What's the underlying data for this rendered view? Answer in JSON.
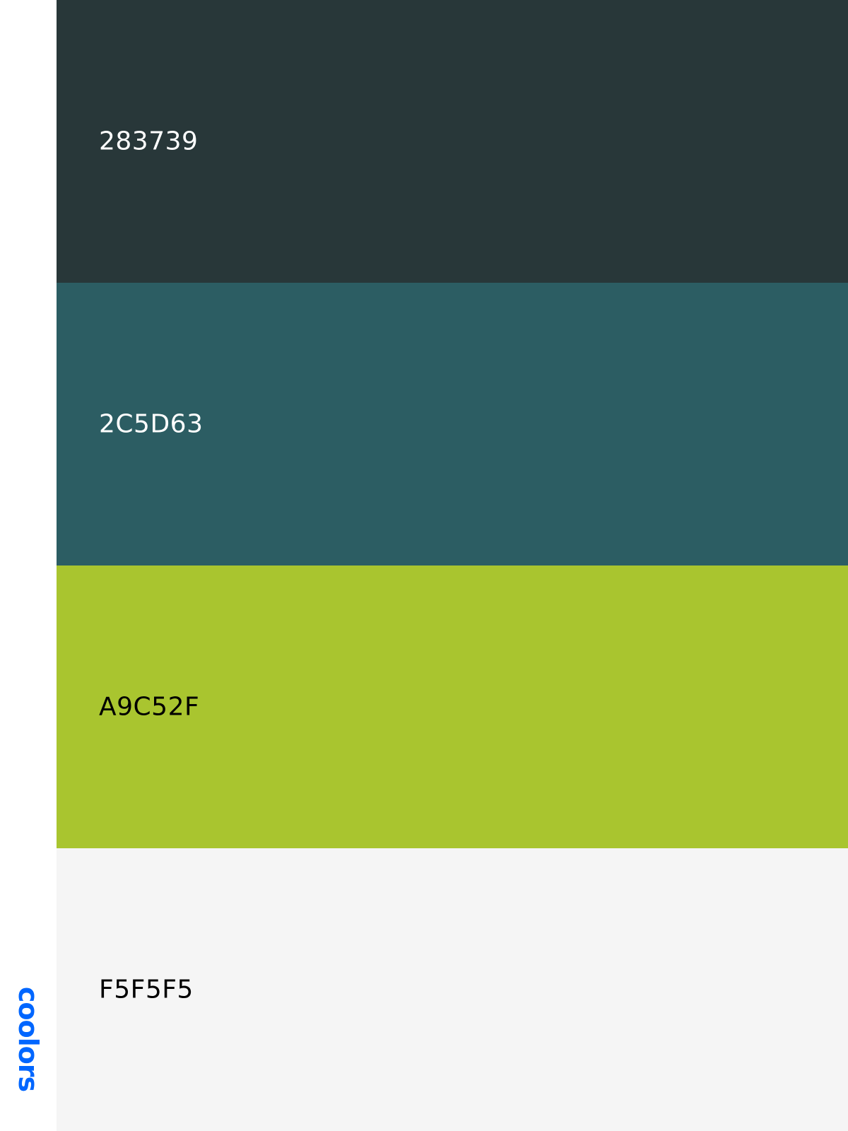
{
  "brand": {
    "logo_text": "coolors",
    "logo_color": "#0066ff"
  },
  "swatches": [
    {
      "code": "283739",
      "color": "#283739",
      "text_color": "#ffffff"
    },
    {
      "code": "2C5D63",
      "color": "#2C5D63",
      "text_color": "#ffffff"
    },
    {
      "code": "A9C52F",
      "color": "#A9C52F",
      "text_color": "#000000"
    },
    {
      "code": "F5F5F5",
      "color": "#F5F5F5",
      "text_color": "#000000"
    }
  ]
}
